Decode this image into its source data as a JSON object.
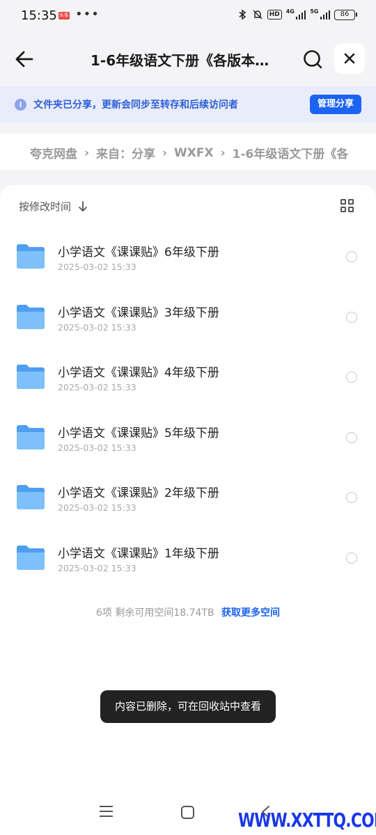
{
  "status_bar": {
    "time": "15:35",
    "app_badge": "头条",
    "more": "•••",
    "network_1": "4G",
    "network_2": "5G",
    "hd_label": "HD",
    "battery": "86"
  },
  "header": {
    "title": "1-6年级语文下册《各版本…",
    "back_icon": "arrow-left-icon",
    "search_icon": "search-icon",
    "close_icon": "close-icon"
  },
  "banner": {
    "info_icon": "i",
    "text": "文件夹已分享，更新会同步至转存和后续访问者",
    "manage_label": "管理分享"
  },
  "breadcrumb": {
    "items": [
      "夸克网盘",
      "来自：分享",
      "WXFX",
      "1-6年级语文下册《各"
    ]
  },
  "toolbar": {
    "sort_label": "按修改时间",
    "sort_icon": "arrow-down-icon",
    "view_icon": "grid-view-icon"
  },
  "files": [
    {
      "name": "小学语文《课课贴》6年级下册",
      "date": "2025-03-02 15:33"
    },
    {
      "name": "小学语文《课课贴》3年级下册",
      "date": "2025-03-02 15:33"
    },
    {
      "name": "小学语文《课课贴》4年级下册",
      "date": "2025-03-02 15:33"
    },
    {
      "name": "小学语文《课课贴》5年级下册",
      "date": "2025-03-02 15:33"
    },
    {
      "name": "小学语文《课课贴》2年级下册",
      "date": "2025-03-02 15:33"
    },
    {
      "name": "小学语文《课课贴》1年级下册",
      "date": "2025-03-02 15:33"
    }
  ],
  "footer": {
    "count_text": "6项 剩余可用空间18.74TB",
    "link_text": "获取更多空间"
  },
  "toast": "内容已删除，可在回收站中查看",
  "watermark": "WWW.XXTTQ.COM",
  "colors": {
    "accent": "#1b63f2",
    "banner_bg": "#e9edfb",
    "folder": "#5aa9f5",
    "toast_bg": "#222222"
  }
}
